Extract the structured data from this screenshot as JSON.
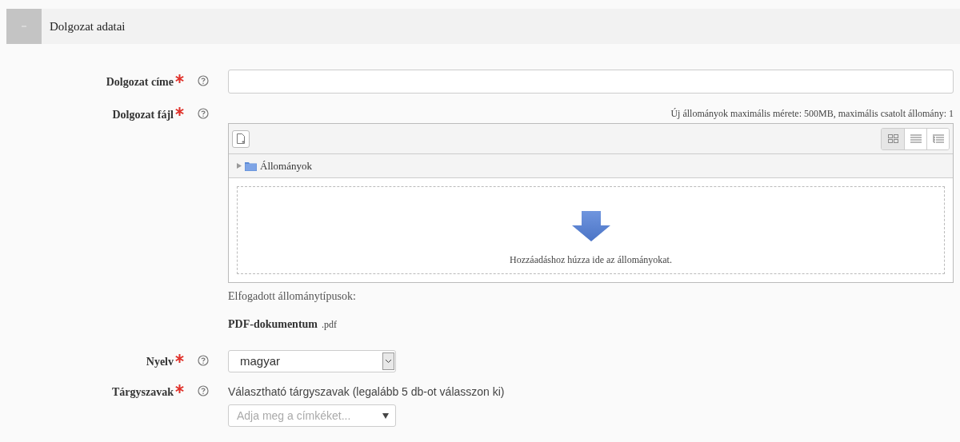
{
  "section": {
    "title": "Dolgozat adatai",
    "expanded": true
  },
  "fields": [
    {
      "kind": "text",
      "label": "Dolgozat címe",
      "required": true
    },
    {
      "kind": "file",
      "label": "Dolgozat fájl",
      "required": true,
      "limits": "Új állományok maximális mérete: 500MB, maximális csatolt állomány: 1",
      "views": [
        {
          "kind": "icons",
          "selected": true
        },
        {
          "kind": "list",
          "selected": false
        },
        {
          "kind": "tree",
          "selected": false
        }
      ],
      "folder": "Állományok",
      "drop_hint": "Hozzáadáshoz húzza ide az állományokat.",
      "accepted_label": "Elfogadott állománytípusok:",
      "accepted_name": "PDF-dokumentum",
      "accepted_ext": ".pdf"
    },
    {
      "kind": "select",
      "label": "Nyelv",
      "required": true,
      "value": "magyar"
    },
    {
      "kind": "tags",
      "label": "Tárgyszavak",
      "required": true,
      "hint": "Választható tárgyszavak (legalább 5 db-ot válasszon ki)",
      "placeholder": "Adja meg a címkéket..."
    }
  ]
}
